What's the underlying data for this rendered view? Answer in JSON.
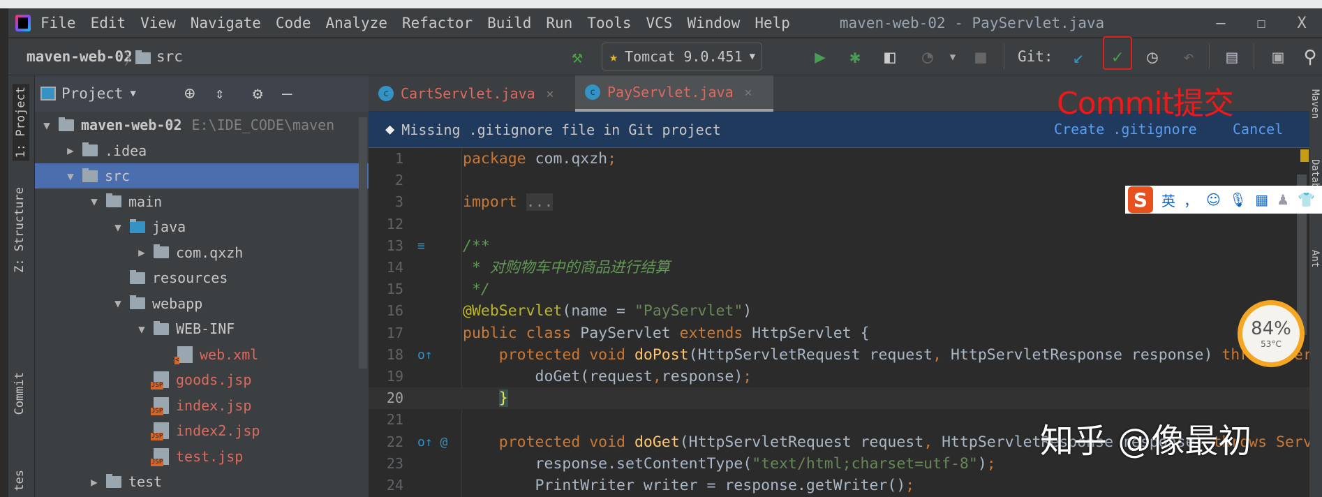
{
  "window": {
    "title": "maven-web-02 - PayServlet.java",
    "minimize": "–",
    "maximize": "☐",
    "close": "X"
  },
  "menu": [
    "File",
    "Edit",
    "View",
    "Navigate",
    "Code",
    "Analyze",
    "Refactor",
    "Build",
    "Run",
    "Tools",
    "VCS",
    "Window",
    "Help"
  ],
  "breadcrumb": {
    "project": "maven-web-02",
    "folder": "src"
  },
  "toolbar": {
    "run_config": "Tomcat 9.0.451",
    "git_label": "Git:"
  },
  "left_tabs": [
    "1: Project",
    "Z: Structure",
    "Commit",
    "tes"
  ],
  "right_tabs": [
    "Maven",
    "Database",
    "Ant"
  ],
  "project_panel": {
    "title": "Project"
  },
  "tree": [
    {
      "label": "maven-web-02",
      "extra": "E:\\IDE_CODE\\maven",
      "level": 0,
      "arrow": "▼",
      "icon": "module",
      "style": "bold"
    },
    {
      "label": ".idea",
      "level": 1,
      "arrow": "▶",
      "icon": "folder"
    },
    {
      "label": "src",
      "level": 1,
      "arrow": "▼",
      "icon": "folder",
      "selected": true
    },
    {
      "label": "main",
      "level": 2,
      "arrow": "▼",
      "icon": "folder"
    },
    {
      "label": "java",
      "level": 3,
      "arrow": "▼",
      "icon": "src-folder"
    },
    {
      "label": "com.qxzh",
      "level": 4,
      "arrow": "▶",
      "icon": "package"
    },
    {
      "label": "resources",
      "level": 3,
      "arrow": "",
      "icon": "res-folder"
    },
    {
      "label": "webapp",
      "level": 3,
      "arrow": "▼",
      "icon": "web-folder"
    },
    {
      "label": "WEB-INF",
      "level": 4,
      "arrow": "▼",
      "icon": "folder"
    },
    {
      "label": "web.xml",
      "level": 5,
      "arrow": "",
      "icon": "xml",
      "style": "red"
    },
    {
      "label": "goods.jsp",
      "level": 4,
      "arrow": "",
      "icon": "jsp",
      "style": "red"
    },
    {
      "label": "index.jsp",
      "level": 4,
      "arrow": "",
      "icon": "jsp",
      "style": "red"
    },
    {
      "label": "index2.jsp",
      "level": 4,
      "arrow": "",
      "icon": "jsp",
      "style": "red"
    },
    {
      "label": "test.jsp",
      "level": 4,
      "arrow": "",
      "icon": "jsp",
      "style": "red"
    },
    {
      "label": "test",
      "level": 2,
      "arrow": "▶",
      "icon": "folder"
    }
  ],
  "tabs": [
    {
      "label": "CartServlet.java",
      "active": false
    },
    {
      "label": "PayServlet.java",
      "active": true
    }
  ],
  "notification": {
    "message": "Missing .gitignore file in Git project",
    "create": "Create .gitignore",
    "cancel": "Cancel"
  },
  "code": [
    {
      "n": "1",
      "t": [
        [
          "package ",
          "kw"
        ],
        [
          "com.qxzh",
          "pl"
        ],
        [
          ";",
          "kw"
        ]
      ]
    },
    {
      "n": "2",
      "t": []
    },
    {
      "n": "3",
      "t": [
        [
          "import ",
          "kw"
        ],
        [
          "...",
          "fold"
        ]
      ]
    },
    {
      "n": "12",
      "t": []
    },
    {
      "n": "13",
      "t": [
        [
          "/**",
          "cm"
        ]
      ],
      "g": "≡"
    },
    {
      "n": "14",
      "t": [
        [
          " * 对购物车中的商品进行结算",
          "cm"
        ]
      ]
    },
    {
      "n": "15",
      "t": [
        [
          " */",
          "cm"
        ]
      ]
    },
    {
      "n": "16",
      "t": [
        [
          "@WebServlet",
          "ann"
        ],
        [
          "(name = ",
          "pl"
        ],
        [
          "\"PayServlet\"",
          "str"
        ],
        [
          ")",
          "pl"
        ]
      ]
    },
    {
      "n": "17",
      "t": [
        [
          "public class ",
          "kw"
        ],
        [
          "PayServlet ",
          "pl"
        ],
        [
          "extends ",
          "kw"
        ],
        [
          "HttpServlet {",
          "pl"
        ]
      ]
    },
    {
      "n": "18",
      "t": [
        [
          "    protected void ",
          "kw"
        ],
        [
          "doPost",
          "fn"
        ],
        [
          "(HttpServletRequest request",
          "pl"
        ],
        [
          ", ",
          "kw"
        ],
        [
          "HttpServletResponse response) ",
          "pl"
        ],
        [
          "throws ServletException",
          "kw"
        ]
      ],
      "g": "o↑"
    },
    {
      "n": "19",
      "t": [
        [
          "        doGet(request",
          "pl"
        ],
        [
          ",",
          "kw"
        ],
        [
          "response)",
          "pl"
        ],
        [
          ";",
          "kw"
        ]
      ]
    },
    {
      "n": "20",
      "t": [
        [
          "    ",
          "pl"
        ],
        [
          "}",
          "brace"
        ]
      ],
      "cur": true
    },
    {
      "n": "21",
      "t": []
    },
    {
      "n": "22",
      "t": [
        [
          "    protected void ",
          "kw"
        ],
        [
          "doGet",
          "fn"
        ],
        [
          "(HttpServletRequest request",
          "pl"
        ],
        [
          ", ",
          "kw"
        ],
        [
          "HttpServletResponse response) ",
          "pl"
        ],
        [
          "throws ServletException",
          "kw"
        ]
      ],
      "g": "o↑ @"
    },
    {
      "n": "23",
      "t": [
        [
          "        response.setContentType(",
          "pl"
        ],
        [
          "\"text/html;charset=utf-8\"",
          "str"
        ],
        [
          ")",
          "pl"
        ],
        [
          ";",
          "kw"
        ]
      ]
    },
    {
      "n": "24",
      "t": [
        [
          "        PrintWriter writer = response.getWriter()",
          "pl"
        ],
        [
          ";",
          "kw"
        ]
      ]
    }
  ],
  "ime": {
    "lang": "英",
    "punct": "，"
  },
  "gauge": {
    "percent": "84%",
    "temp": "53°C"
  },
  "annotation": "Commit提交",
  "watermark": "知乎 @像最初",
  "colors": {
    "accent": "#4b6eaf",
    "annotation": "#f01818",
    "link": "#589df6"
  }
}
